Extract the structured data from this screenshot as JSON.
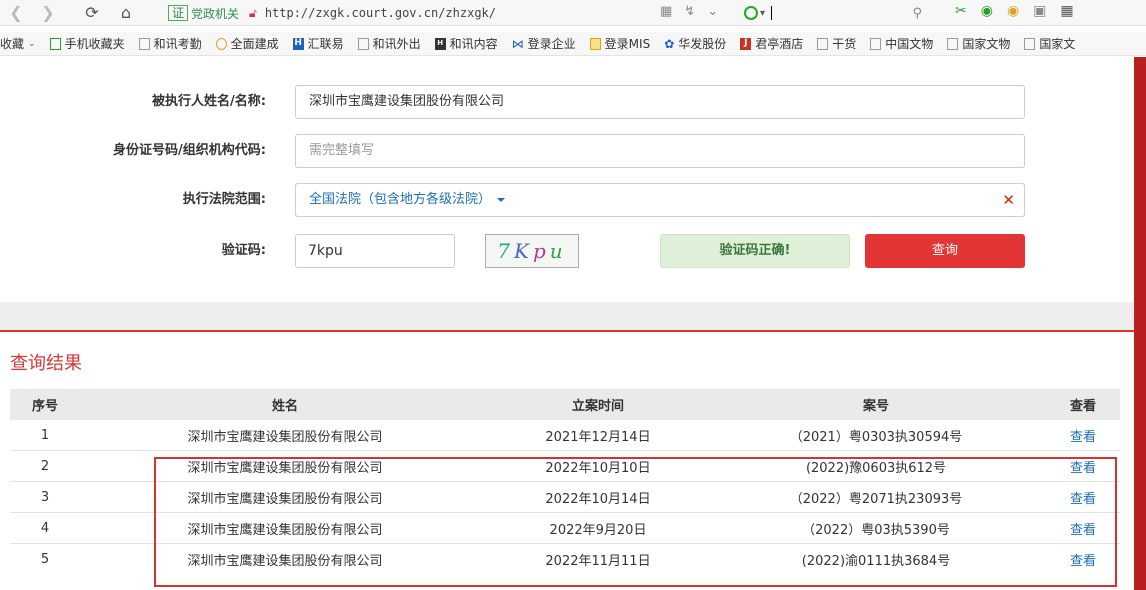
{
  "browser": {
    "cert_label": "证",
    "site_label": "党政机关",
    "url": "http://zxgk.court.gov.cn/zhzxgk/"
  },
  "bookmarks": [
    {
      "label": "收藏",
      "icon": "caret"
    },
    {
      "label": "手机收藏夹",
      "icon": "phone-icon"
    },
    {
      "label": "和讯考勤",
      "icon": "page-icon"
    },
    {
      "label": "全面建成",
      "icon": "circle-icon"
    },
    {
      "label": "汇联易",
      "icon": "hlyi-icon"
    },
    {
      "label": "和讯外出",
      "icon": "page-icon"
    },
    {
      "label": "和讯内容",
      "icon": "hexun-icon"
    },
    {
      "label": "登录企业",
      "icon": "envelope-icon"
    },
    {
      "label": "登录MIS",
      "icon": "doc-icon"
    },
    {
      "label": "华发股份",
      "icon": "paw-icon"
    },
    {
      "label": "君亭酒店",
      "icon": "jt-icon"
    },
    {
      "label": "干货",
      "icon": "page-icon"
    },
    {
      "label": "中国文物",
      "icon": "page-icon"
    },
    {
      "label": "国家文物",
      "icon": "page-icon"
    },
    {
      "label": "国家文",
      "icon": "page-icon"
    }
  ],
  "form": {
    "name_label": "被执行人姓名/名称:",
    "name_value": "深圳市宝鹰建设集团股份有限公司",
    "id_label": "身份证号码/组织机构代码:",
    "id_placeholder": "需完整填写",
    "court_label": "执行法院范围:",
    "court_value": "全国法院（包含地方各级法院）",
    "captcha_label": "验证码:",
    "captcha_value": "7kpu",
    "captcha_image_text": "7Kpu",
    "captcha_status": "验证码正确!",
    "query_button": "查询"
  },
  "results": {
    "title": "查询结果",
    "columns": [
      "序号",
      "姓名",
      "立案时间",
      "案号",
      "查看"
    ],
    "rows": [
      {
        "no": "1",
        "name": "深圳市宝鹰建设集团股份有限公司",
        "date": "2021年12月14日",
        "case": "（2021）粤0303执30594号",
        "view": "查看"
      },
      {
        "no": "2",
        "name": "深圳市宝鹰建设集团股份有限公司",
        "date": "2022年10月10日",
        "case": "(2022)豫0603执612号",
        "view": "查看"
      },
      {
        "no": "3",
        "name": "深圳市宝鹰建设集团股份有限公司",
        "date": "2022年10月14日",
        "case": "（2022）粤2071执23093号",
        "view": "查看"
      },
      {
        "no": "4",
        "name": "深圳市宝鹰建设集团股份有限公司",
        "date": "2022年9月20日",
        "case": "（2022）粤03执5390号",
        "view": "查看"
      },
      {
        "no": "5",
        "name": "深圳市宝鹰建设集团股份有限公司",
        "date": "2022年11月11日",
        "case": "(2022)渝0111执3684号",
        "view": "查看"
      }
    ]
  },
  "colors": {
    "accent_red": "#e33535",
    "link_blue": "#1b6fb8",
    "success_bg": "#dff0d8"
  }
}
